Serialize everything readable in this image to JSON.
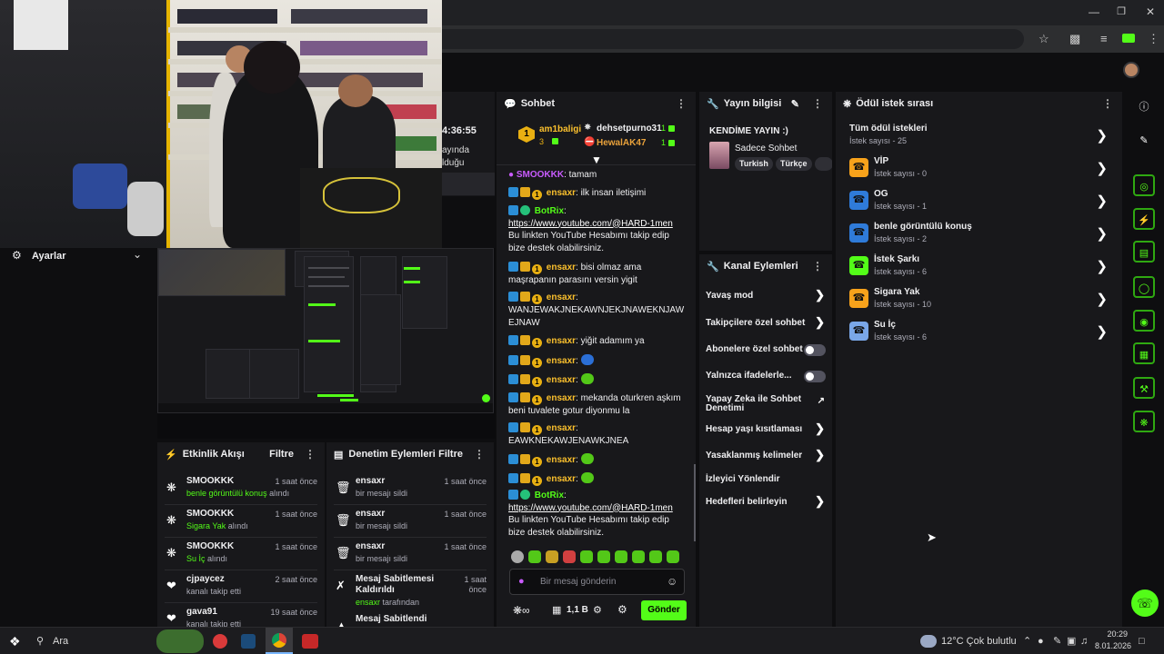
{
  "taskbar": {
    "search_label": "Ara",
    "weather": "12°C  Çok bulutlu",
    "time": "20:29",
    "date": "8.01.2026"
  },
  "left": {
    "settings_label": "Ayarlar",
    "timer": {
      "time": "4:36:55",
      "line1": "ayında",
      "line2": "lduğu"
    }
  },
  "activity": {
    "title": "Etkinlik Akışı",
    "filter": "Filtre",
    "items": [
      {
        "name": "SMOOKKK",
        "time": "1 saat önce",
        "highlight": "benle görüntülü konuş",
        "suffix": " alındı"
      },
      {
        "name": "SMOOKKK",
        "time": "1 saat önce",
        "highlight": "Sigara Yak",
        "suffix": " alındı"
      },
      {
        "name": "SMOOKKK",
        "time": "1 saat önce",
        "highlight": "Su İç",
        "suffix": " alındı"
      },
      {
        "name": "cjpaycez",
        "time": "2 saat önce",
        "highlight": "",
        "suffix": "kanalı takip etti"
      },
      {
        "name": "gava91",
        "time": "19 saat önce",
        "highlight": "",
        "suffix": "kanalı takip etti"
      }
    ]
  },
  "moderation": {
    "title": "Denetim Eylemleri",
    "filter": "Filtre",
    "items": [
      {
        "name": "ensaxr",
        "time": "1 saat önce",
        "sub": "bir mesajı sildi"
      },
      {
        "name": "ensaxr",
        "time": "1 saat önce",
        "sub": "bir mesajı sildi"
      },
      {
        "name": "ensaxr",
        "time": "1 saat önce",
        "sub": "bir mesajı sildi"
      },
      {
        "name1": "Mesaj Sabitlemesi",
        "name2": "Kaldırıldı",
        "time1": "1 saat",
        "time2": "önce",
        "user": "ensaxr",
        "sub": " tarafından"
      },
      {
        "name": "Mesaj Sabitlendi"
      }
    ]
  },
  "chat": {
    "title": "Sohbet",
    "leaderboard": [
      {
        "rank": "1",
        "name": "am1baligi",
        "count": "3"
      },
      {
        "name": "dehsetpurno31",
        "count": "1"
      },
      {
        "name": "HewalAK47",
        "count": "1"
      }
    ],
    "messages": {
      "m0_user": "SMOOKKK",
      "m0_text": ": tamam",
      "m1_user": "ensaxr",
      "m1_text": ": ilk insan iletişimi",
      "m2_user": "BotRix",
      "m2_link": "https://www.youtube.com/@HARD-1men",
      "m2_text": " Bu linkten YouTube Hesabımı takip edip bize destek olabilirsiniz.",
      "m3_user": "ensaxr",
      "m3_text": ": bisi olmaz ama maşrapanın parasını versin yigit",
      "m4_user": "ensaxr",
      "m4_text": ": WANJEWAKJNEKAWNJEKJNAWEKNJAWEJNAW",
      "m5_user": "ensaxr",
      "m5_text": ": yiğit adamım ya",
      "m6_user": "ensaxr",
      "m7_user": "ensaxr",
      "m8_user": "ensaxr",
      "m8_text": ": mekanda oturkren aşkım beni tuvalete gotur diyonmu la",
      "m9_user": "ensaxr",
      "m9_text": ": EAWKNEKAWJENAWKJNEA",
      "m10_user": "ensaxr",
      "m11_user": "ensaxr",
      "m12_user": "BotRix",
      "m12_link": "https://www.youtube.com/@HARD-1men",
      "m12_text": " Bu linkten YouTube Hesabımı takip edip bize destek olabilirsiniz."
    },
    "input_placeholder": "Bir mesaj gönderin",
    "points": "1,1 B",
    "send": "Gönder"
  },
  "streaminfo": {
    "title": "Yayın bilgisi",
    "stream_title": "KENDİME YAYIN :)",
    "category": "Sadece Sohbet",
    "tags": [
      "Turkish",
      "Türkçe"
    ]
  },
  "channel_actions": {
    "title": "Kanal Eylemleri",
    "items": [
      {
        "label": "Yavaş mod"
      },
      {
        "label": "Takipçilere özel sohbet"
      },
      {
        "label": "Abonelere özel sohbet"
      },
      {
        "label": "Yalnızca ifadelerle..."
      },
      {
        "label1": "Yapay Zeka ile Sohbet",
        "label2": "Denetimi"
      },
      {
        "label": "Hesap yaşı kısıtlaması"
      },
      {
        "label": "Yasaklanmış kelimeler"
      },
      {
        "label": "İzleyici Yönlendir"
      },
      {
        "label": "Hedefleri belirleyin"
      }
    ]
  },
  "rewards": {
    "title": "Ödül istek sırası",
    "all_title": "Tüm ödül istekleri",
    "all_count": "İstek sayısı - 25",
    "items": [
      {
        "title": "VİP",
        "count": "İstek sayısı - 0",
        "color": "#f7a21b"
      },
      {
        "title": "OG",
        "count": "İstek sayısı - 1",
        "color": "#2f7bd9"
      },
      {
        "title": "benle görüntülü konuş",
        "count": "İstek sayısı - 2",
        "color": "#2f7bd9"
      },
      {
        "title": "İstek Şarkı",
        "count": "İstek sayısı - 6",
        "color": "#53fc18"
      },
      {
        "title": "Sigara Yak",
        "count": "İstek sayısı - 10",
        "color": "#f7a21b"
      },
      {
        "title": "Su İç",
        "count": "İstek sayısı - 6",
        "color": "#7aa7e8"
      }
    ]
  },
  "colors": {
    "accent": "#53fc18",
    "panel": "#18181b",
    "bg": "#0e0e10"
  }
}
